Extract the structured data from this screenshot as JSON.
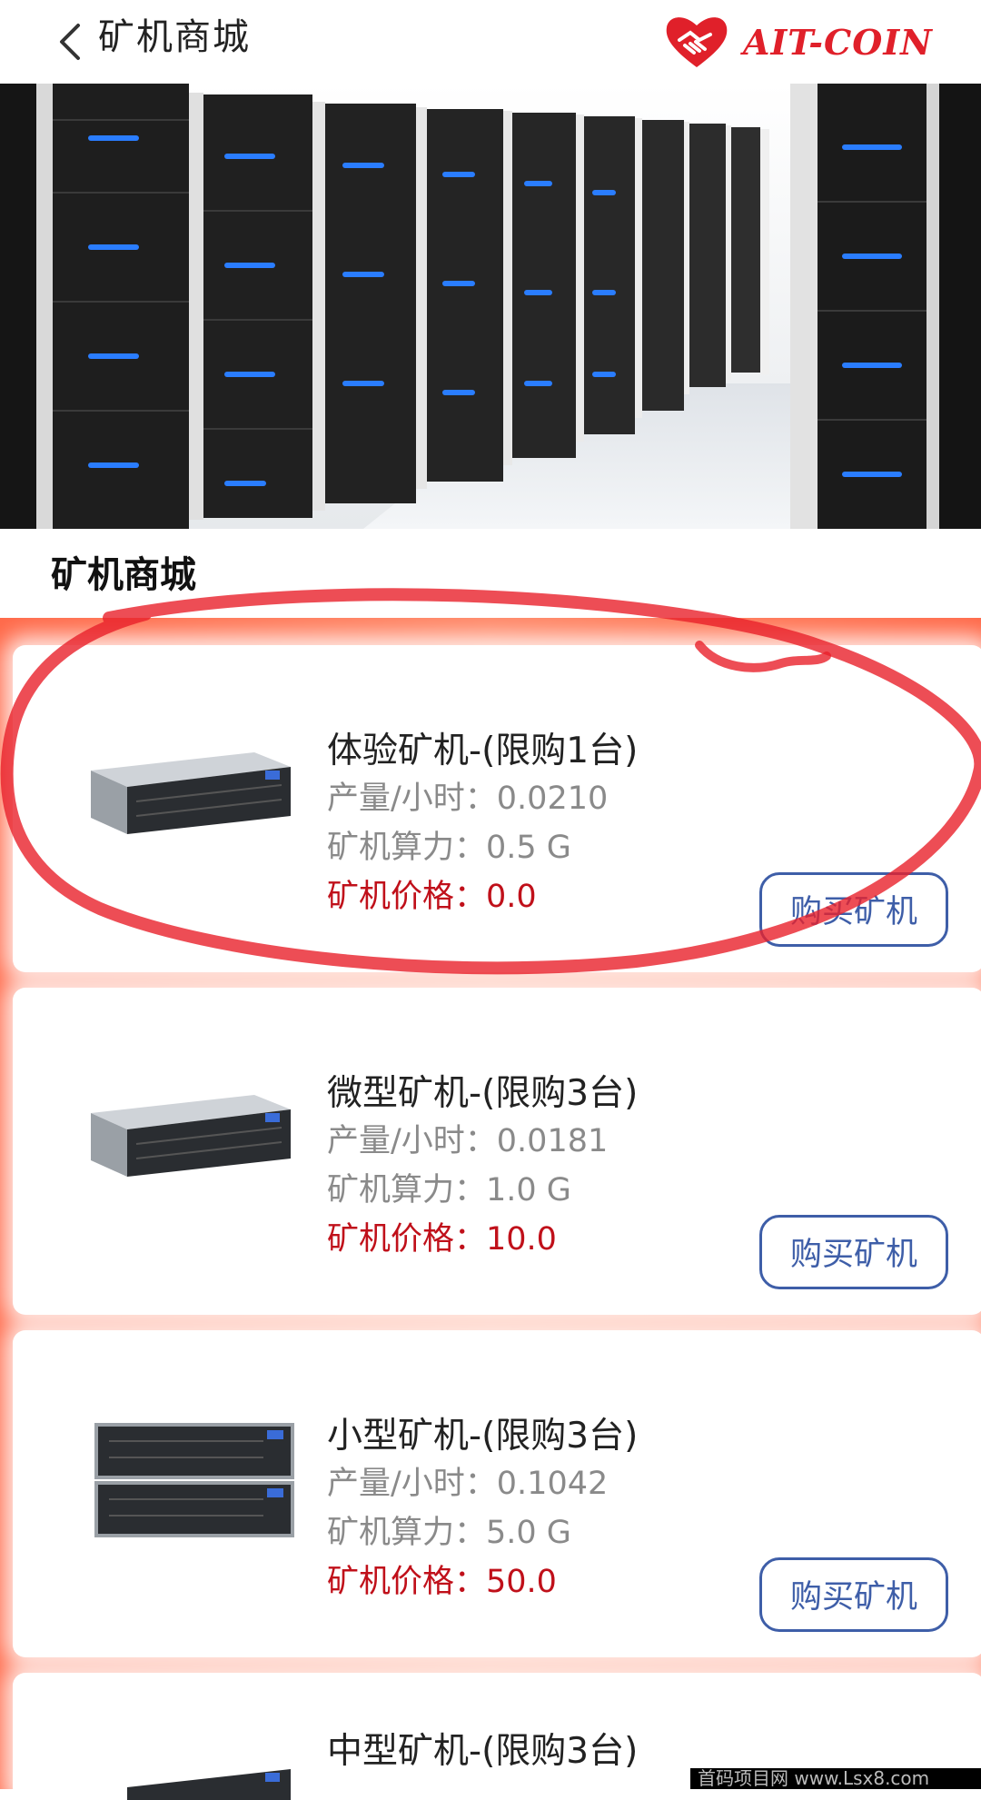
{
  "header": {
    "title": "矿机商城",
    "logo_text": "AIT-COIN"
  },
  "section": {
    "title": "矿机商城"
  },
  "products": [
    {
      "name": "体验矿机-(限购1台)",
      "output": "产量/小时：0.0210",
      "hashrate": "矿机算力：0.5 G",
      "price": "矿机价格：0.0",
      "button": "购买矿机"
    },
    {
      "name": "微型矿机-(限购3台)",
      "output": "产量/小时：0.0181",
      "hashrate": "矿机算力：1.0 G",
      "price": "矿机价格：10.0",
      "button": "购买矿机"
    },
    {
      "name": "小型矿机-(限购3台)",
      "output": "产量/小时：0.1042",
      "hashrate": "矿机算力：5.0 G",
      "price": "矿机价格：50.0",
      "button": "购买矿机"
    },
    {
      "name": "中型矿机-(限购3台)"
    }
  ],
  "watermark": "首码项目网 www.Lsx8.com",
  "colors": {
    "accent": "#3e5ea8",
    "price": "#c0101a",
    "brand": "#e0202a",
    "list_bg": "#ff7a5a",
    "annotation": "#e8202a"
  }
}
